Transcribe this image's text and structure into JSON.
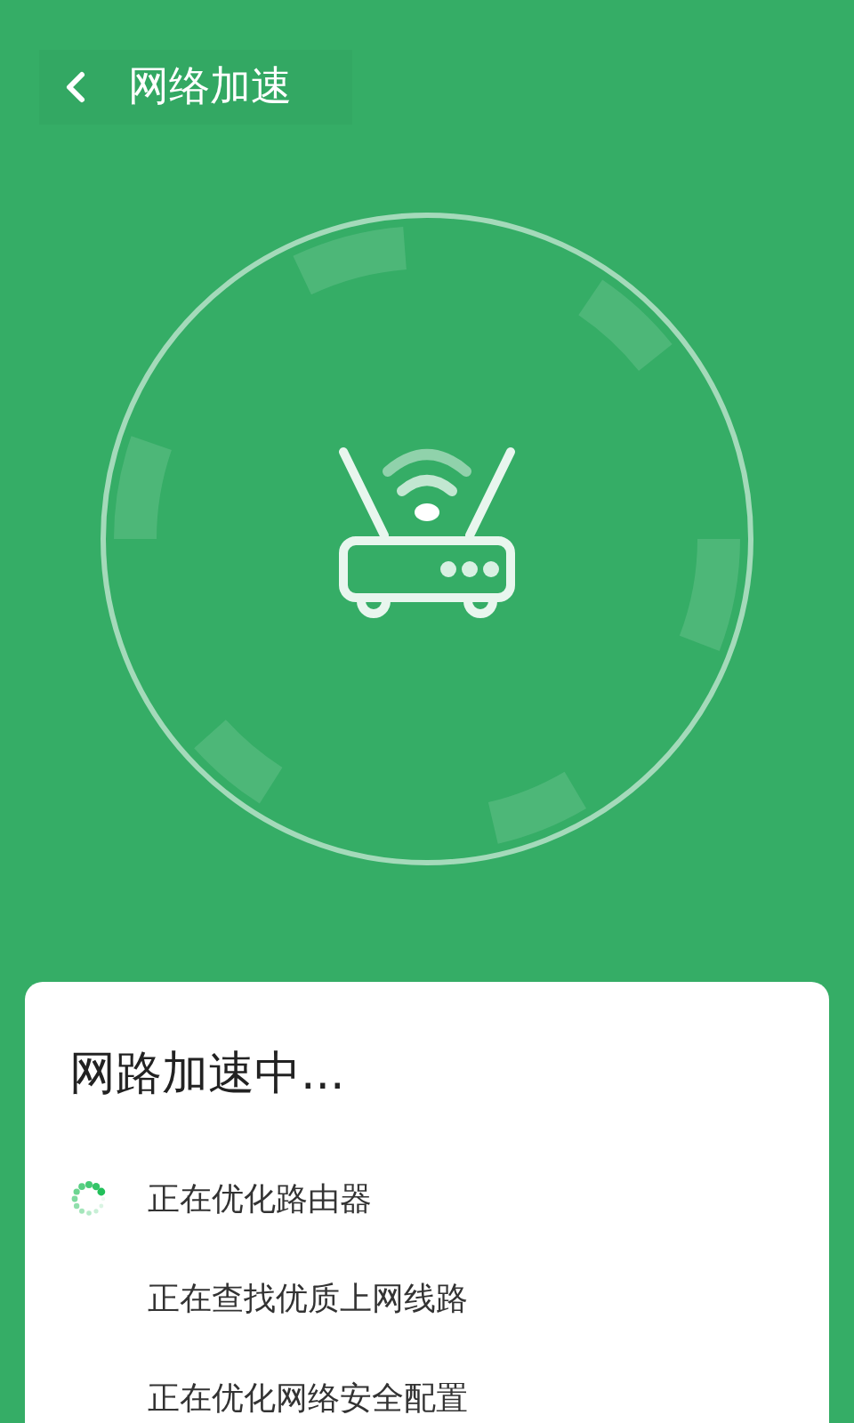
{
  "header": {
    "title": "网络加速"
  },
  "card": {
    "title": "网路加速中...",
    "steps": [
      {
        "label": "正在优化路由器",
        "loading": true
      },
      {
        "label": "正在查找优质上网线路",
        "loading": false
      },
      {
        "label": "正在优化网络安全配置",
        "loading": false
      }
    ]
  }
}
